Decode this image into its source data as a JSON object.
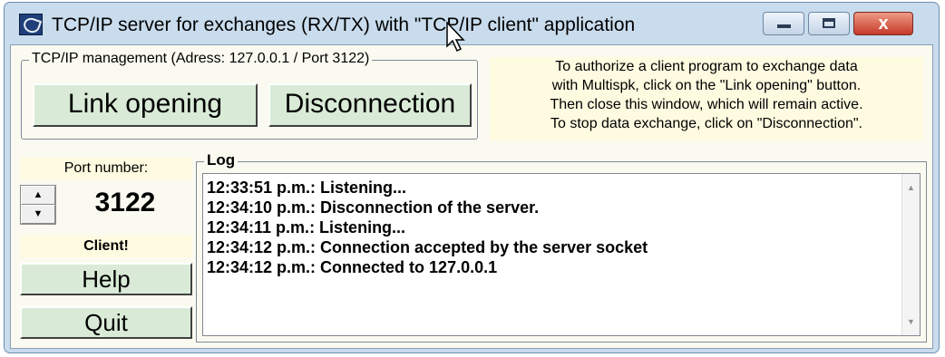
{
  "window": {
    "title": "TCP/IP server for exchanges (RX/TX) with \"TCP/IP client\" application",
    "close_glyph": "x"
  },
  "management": {
    "legend": "TCP/IP management (Adress: 127.0.0.1 / Port 3122)",
    "link_opening_label": "Link opening",
    "disconnection_label": "Disconnection"
  },
  "info": {
    "lines": [
      "To authorize a client program to exchange data",
      "with Multispk, click on the \"Link opening\" button.",
      "Then close this window, which will remain active.",
      "To stop data exchange, click on \"Disconnection\"."
    ]
  },
  "port": {
    "label": "Port number:",
    "value": "3122"
  },
  "client_status": "Client!",
  "buttons": {
    "help": "Help",
    "quit": "Quit"
  },
  "log": {
    "legend": "Log",
    "lines": [
      "12:33:51 p.m.: Listening...",
      "12:34:10 p.m.: Disconnection of the server.",
      "12:34:11 p.m.: Listening...",
      "12:34:12 p.m.: Connection accepted by the server socket",
      "12:34:12 p.m.: Connected to 127.0.0.1"
    ]
  },
  "icons": {
    "app": "satellite-dish-icon",
    "minimize": "minimize-icon",
    "maximize": "maximize-icon",
    "close": "close-icon",
    "cursor": "mouse-pointer-icon"
  },
  "colors": {
    "frame": "#c9dced",
    "client_bg": "#fafaf0",
    "info_bg": "#fffbe0",
    "button_bg": "#d9ebd7",
    "close_button": "#c6392a"
  }
}
